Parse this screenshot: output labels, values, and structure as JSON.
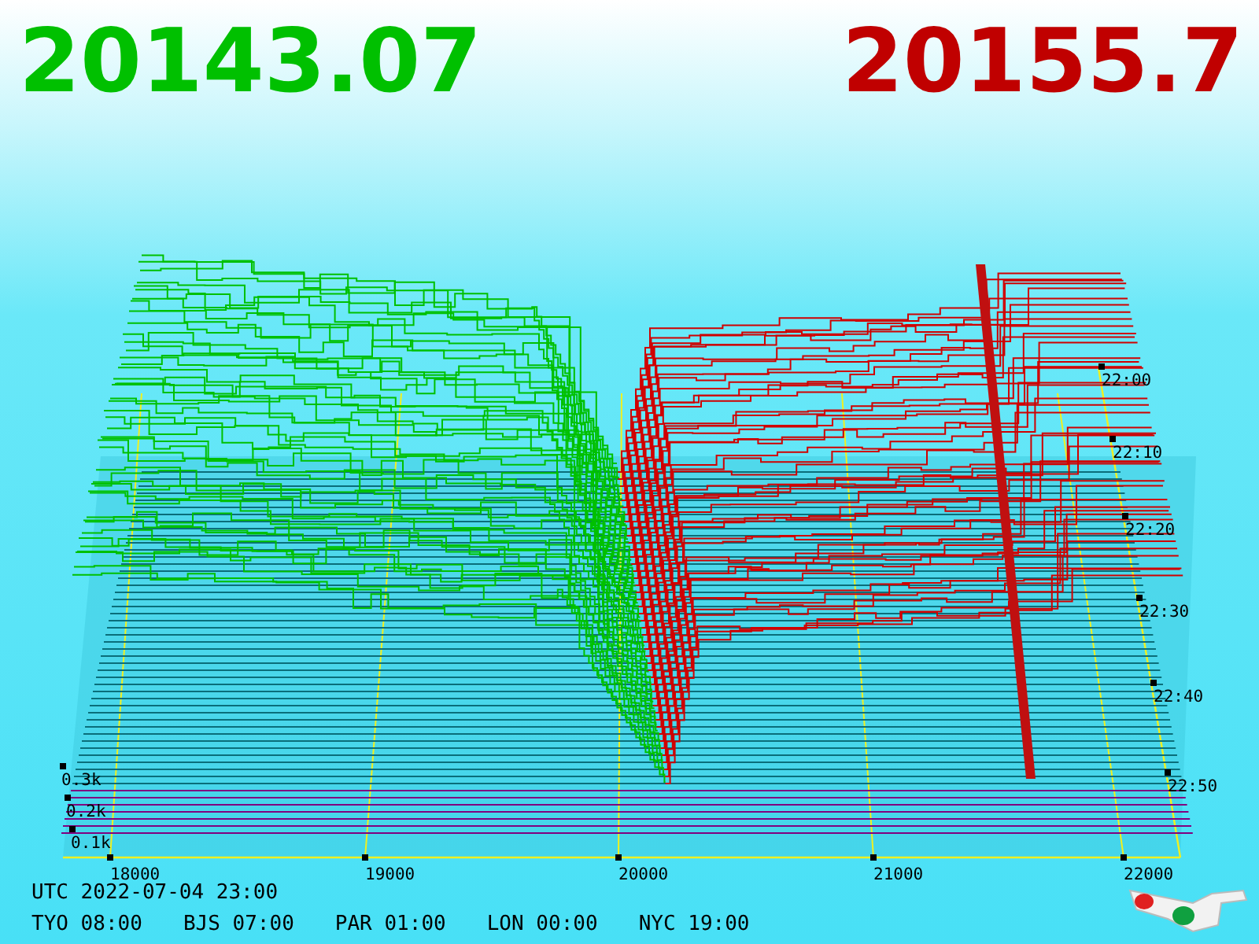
{
  "prices": {
    "bid": "20143.07",
    "ask": "20155.7"
  },
  "chart": {
    "price_labels": [
      "18000",
      "19000",
      "20000",
      "21000",
      "22000"
    ],
    "time_labels": [
      "22:00",
      "22:10",
      "22:20",
      "22:30",
      "22:40",
      "22:50"
    ],
    "volume_labels": [
      "0.3k",
      "0.2k",
      "0.1k"
    ]
  },
  "clock": {
    "utc": "UTC 2022-07-04 23:00",
    "zones": [
      "TYO 08:00",
      "BJS 07:00",
      "PAR 01:00",
      "LON 00:00",
      "NYC 19:00"
    ]
  }
}
